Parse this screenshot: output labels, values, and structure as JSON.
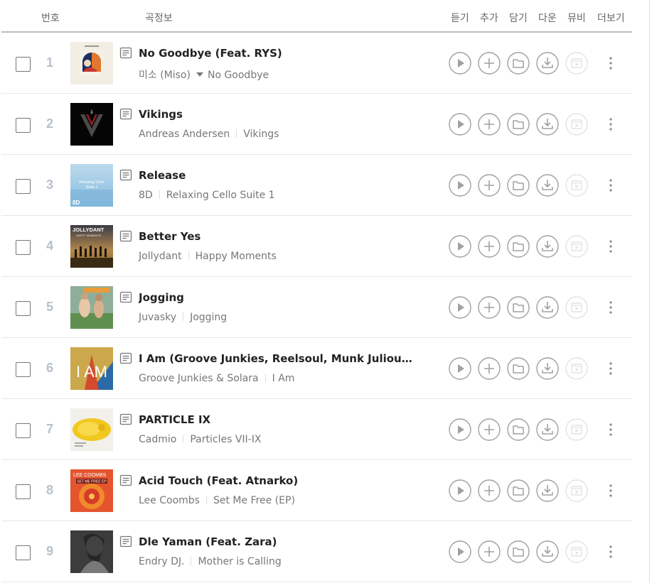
{
  "header": {
    "col_no": "번호",
    "col_song": "곡정보",
    "col_listen": "듣기",
    "col_add": "추가",
    "col_save": "담기",
    "col_download": "다운",
    "col_mv": "뮤비",
    "col_more": "더보기"
  },
  "songs": [
    {
      "no": "1",
      "title": "No Goodbye (Feat. RYS)",
      "artist": "미소 (Miso)",
      "album": "No Goodbye",
      "has_artist_dropdown": true
    },
    {
      "no": "2",
      "title": "Vikings",
      "artist": "Andreas Andersen",
      "album": "Vikings"
    },
    {
      "no": "3",
      "title": "Release",
      "artist": "8D",
      "album": "Relaxing Cello Suite 1"
    },
    {
      "no": "4",
      "title": "Better Yes",
      "artist": "Jollydant",
      "album": "Happy Moments"
    },
    {
      "no": "5",
      "title": "Jogging",
      "artist": "Juvasky",
      "album": "Jogging"
    },
    {
      "no": "6",
      "title": "I Am (Groove Junkies, Reelsoul, Munk Julious Ma…",
      "artist": "Groove Junkies & Solara",
      "album": "I Am"
    },
    {
      "no": "7",
      "title": "PARTICLE IX",
      "artist": "Cadmio",
      "album": "Particles VII-IX"
    },
    {
      "no": "8",
      "title": "Acid Touch (Feat. Atnarko)",
      "artist": "Lee Coombs",
      "album": "Set Me Free (EP)"
    },
    {
      "no": "9",
      "title": "Dle Yaman (Feat. Zara)",
      "artist": "Endry DJ.",
      "album": "Mother is Calling"
    }
  ],
  "album_art_text": {
    "a3_line1": "Relaxing Cello",
    "a3_line2": "Suite 1",
    "a3_corner": "8D",
    "a4_line1": "JOLLYDANT",
    "a4_line2": "HAPPY MOMENTS",
    "a6": "I AM",
    "a8_line1": "LEE COOMBS",
    "a8_line2": "SET ME FREE EP"
  },
  "colors": {
    "icon_stroke": "#a0a0a0",
    "mv_disabled": "#e6e6e6",
    "number": "#b7c0cc"
  }
}
